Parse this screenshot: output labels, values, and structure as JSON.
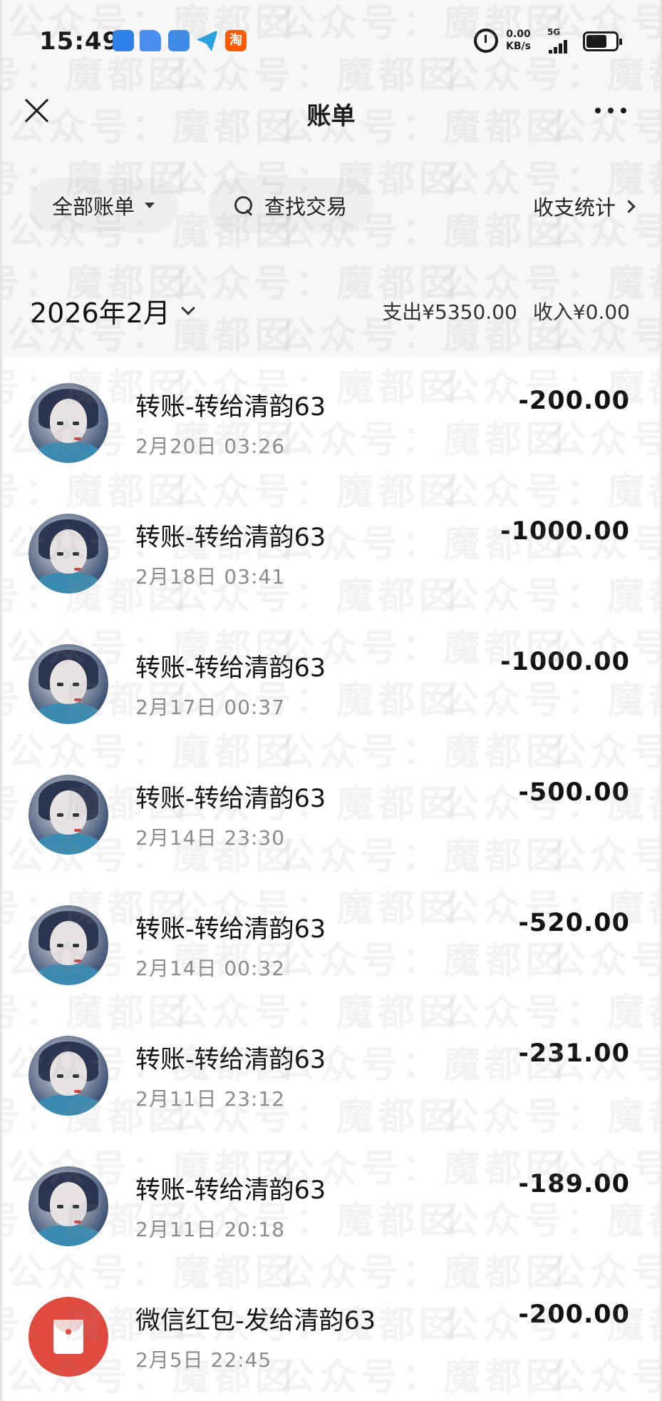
{
  "status_bar": {
    "time": "15:49",
    "network_speed": "0.00",
    "network_unit": "KB/s",
    "signal_type": "5G",
    "app_icons": [
      "app-icon-blue",
      "app-icon-doc",
      "app-icon-browser",
      "telegram-icon",
      "taobao-icon"
    ],
    "taobao_glyph": "淘"
  },
  "nav": {
    "title": "账单"
  },
  "filters": {
    "all_bills": "全部账单",
    "search": "查找交易",
    "stats": "收支统计"
  },
  "month": {
    "label": "2026年2月",
    "expense": "支出¥5350.00",
    "income": "收入¥0.00"
  },
  "transactions": [
    {
      "title": "转账-转给清韵63",
      "datetime": "2月20日 03:26",
      "amount": "-200.00",
      "icon": "avatar"
    },
    {
      "title": "转账-转给清韵63",
      "datetime": "2月18日 03:41",
      "amount": "-1000.00",
      "icon": "avatar"
    },
    {
      "title": "转账-转给清韵63",
      "datetime": "2月17日 00:37",
      "amount": "-1000.00",
      "icon": "avatar"
    },
    {
      "title": "转账-转给清韵63",
      "datetime": "2月14日 23:30",
      "amount": "-500.00",
      "icon": "avatar"
    },
    {
      "title": "转账-转给清韵63",
      "datetime": "2月14日 00:32",
      "amount": "-520.00",
      "icon": "avatar"
    },
    {
      "title": "转账-转给清韵63",
      "datetime": "2月11日 23:12",
      "amount": "-231.00",
      "icon": "avatar"
    },
    {
      "title": "转账-转给清韵63",
      "datetime": "2月11日 20:18",
      "amount": "-189.00",
      "icon": "avatar"
    },
    {
      "title": "微信红包-发给清韵63",
      "datetime": "2月5日 22:45",
      "amount": "-200.00",
      "icon": "red-packet-icon"
    }
  ],
  "watermark": "公众号：魔都囡"
}
